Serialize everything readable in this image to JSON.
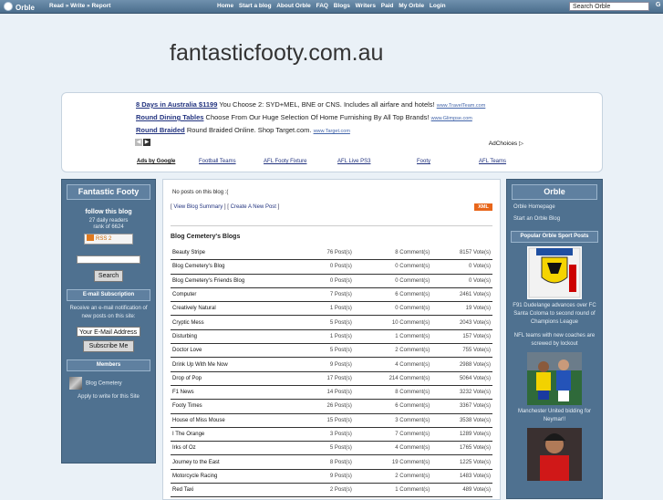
{
  "topbar": {
    "logo": "Orble",
    "tagline": "Read » Write » Report",
    "nav": [
      "Home",
      "Start a blog",
      "About Orble",
      "FAQ",
      "Blogs",
      "Writers",
      "Paid",
      "My Orble",
      "Login"
    ],
    "search_placeholder": "Search Orble",
    "go": "G"
  },
  "site_title": "fantasticfooty.com.au",
  "ads": [
    {
      "title": "8 Days in Australia $1199",
      "text": "You Choose 2: SYD+MEL, BNE or CNS. Includes all airfare and hotels!",
      "url": "www.TravelTeam.com"
    },
    {
      "title": "Round Dining Tables",
      "text": "Choose From Our Huge Selection Of Home Furnishing By All Top Brands!",
      "url": "www.Glimpse.com"
    },
    {
      "title": "Round Braided",
      "text": "Round Braided Online. Shop Target.com.",
      "url": "www.Target.com"
    }
  ],
  "adchoices": "AdChoices",
  "ad_links": {
    "label": "Ads by Google",
    "items": [
      "Football Teams",
      "AFL Footy Fixture",
      "AFL Live PS3",
      "Footy",
      "AFL Teams"
    ]
  },
  "left": {
    "title": "Fantastic Footy",
    "follow": "follow this blog",
    "readers": "27 daily readers",
    "rank": "rank of 6624",
    "rss": "RSS 2",
    "search_btn": "Search",
    "email_title": "E-mail Subscription",
    "email_desc": "Receive an e-mail notification of new posts on this site:",
    "email_value": "Your E-Mail Address",
    "subscribe_btn": "Subscribe Me",
    "members_title": "Members",
    "member": "Blog Cemetery",
    "apply": "Apply to write for this Site"
  },
  "main": {
    "no_posts": "No posts on this blog :(",
    "view_summary": "View Blog Summary",
    "create_post": "Create A New Post",
    "xml": "XML",
    "blogs_title": "Blog Cemetery's Blogs",
    "blogs": [
      {
        "name": "Beauty Stripe",
        "posts": "76 Post(s)",
        "comments": "8 Comment(s)",
        "votes": "8157 Vote(s)"
      },
      {
        "name": "Blog Cemetery's Blog",
        "posts": "0 Post(s)",
        "comments": "0 Comment(s)",
        "votes": "0 Vote(s)"
      },
      {
        "name": "Blog Cemetery's Friends Blog",
        "posts": "0 Post(s)",
        "comments": "0 Comment(s)",
        "votes": "0 Vote(s)"
      },
      {
        "name": "Computer",
        "posts": "7 Post(s)",
        "comments": "6 Comment(s)",
        "votes": "2461 Vote(s)"
      },
      {
        "name": "Creatively Natural",
        "posts": "1 Post(s)",
        "comments": "0 Comment(s)",
        "votes": "19 Vote(s)"
      },
      {
        "name": "Cryptic Mess",
        "posts": "5 Post(s)",
        "comments": "10 Comment(s)",
        "votes": "2043 Vote(s)"
      },
      {
        "name": "Disturbing",
        "posts": "1 Post(s)",
        "comments": "1 Comment(s)",
        "votes": "157 Vote(s)"
      },
      {
        "name": "Doctor Love",
        "posts": "5 Post(s)",
        "comments": "2 Comment(s)",
        "votes": "755 Vote(s)"
      },
      {
        "name": "Drink Up With Me Now",
        "posts": "9 Post(s)",
        "comments": "4 Comment(s)",
        "votes": "2988 Vote(s)"
      },
      {
        "name": "Drop of Pop",
        "posts": "17 Post(s)",
        "comments": "214 Comment(s)",
        "votes": "5064 Vote(s)"
      },
      {
        "name": "F1 News",
        "posts": "14 Post(s)",
        "comments": "8 Comment(s)",
        "votes": "3232 Vote(s)"
      },
      {
        "name": "Footy Times",
        "posts": "26 Post(s)",
        "comments": "6 Comment(s)",
        "votes": "3367 Vote(s)"
      },
      {
        "name": "House of Miss Mouse",
        "posts": "15 Post(s)",
        "comments": "3 Comment(s)",
        "votes": "3538 Vote(s)"
      },
      {
        "name": "I The Orange",
        "posts": "3 Post(s)",
        "comments": "7 Comment(s)",
        "votes": "1289 Vote(s)"
      },
      {
        "name": "Irks of Oz",
        "posts": "5 Post(s)",
        "comments": "4 Comment(s)",
        "votes": "1765 Vote(s)"
      },
      {
        "name": "Journey to the East",
        "posts": "8 Post(s)",
        "comments": "19 Comment(s)",
        "votes": "1225 Vote(s)"
      },
      {
        "name": "Motorcycle Racing",
        "posts": "9 Post(s)",
        "comments": "2 Comment(s)",
        "votes": "1483 Vote(s)"
      },
      {
        "name": "Red Taxi",
        "posts": "2 Post(s)",
        "comments": "1 Comment(s)",
        "votes": "489 Vote(s)"
      }
    ]
  },
  "right": {
    "title": "Orble",
    "links": [
      "Orble Homepage",
      "Start an Orble Blog"
    ],
    "popular_title": "Popular Orble Sport Posts",
    "news": [
      "F91 Dudelange advances over FC Santa Coloma to second round of Champions League",
      "NFL teams with new coaches are screwed by lockout",
      "Manchester United bidding for Neymar!!"
    ]
  }
}
